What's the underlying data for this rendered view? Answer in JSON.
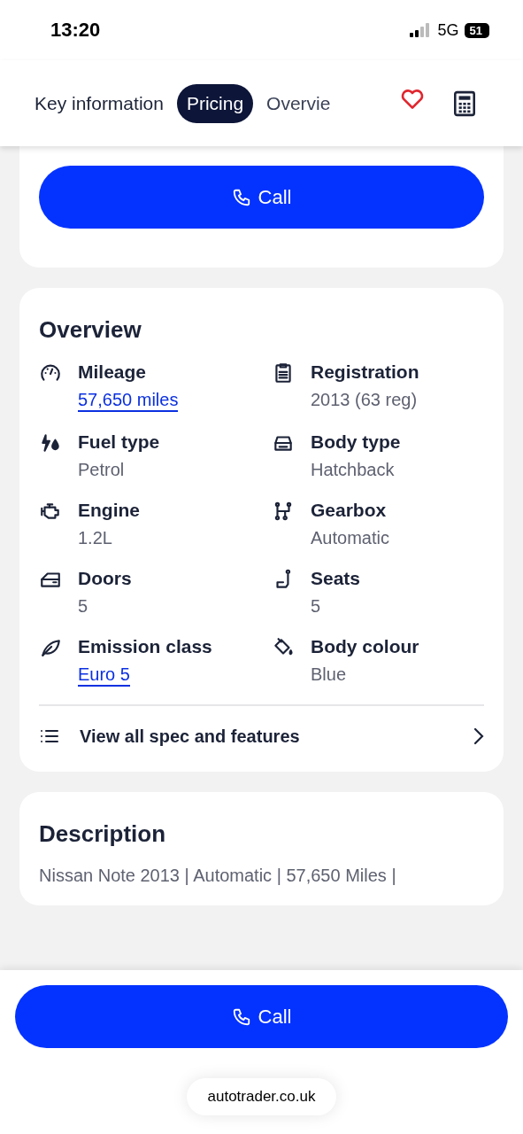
{
  "status_bar": {
    "time": "13:20",
    "network": "5G",
    "battery": "51"
  },
  "tabs": [
    {
      "label": "Key information",
      "selected": false
    },
    {
      "label": "Pricing",
      "selected": true
    },
    {
      "label": "Overvie",
      "selected": false
    }
  ],
  "top_card": {
    "button": "Call"
  },
  "overview": {
    "title": "Overview",
    "specs": [
      {
        "label": "Mileage",
        "value": "57,650 miles",
        "link": true
      },
      {
        "label": "Registration",
        "value": "2013 (63 reg)",
        "link": false
      },
      {
        "label": "Fuel type",
        "value": "Petrol",
        "link": false
      },
      {
        "label": "Body type",
        "value": "Hatchback",
        "link": false
      },
      {
        "label": "Engine",
        "value": "1.2L",
        "link": false
      },
      {
        "label": "Gearbox",
        "value": "Automatic",
        "link": false
      },
      {
        "label": "Doors",
        "value": "5",
        "link": false
      },
      {
        "label": "Seats",
        "value": "5",
        "link": false
      },
      {
        "label": "Emission class",
        "value": "Euro 5",
        "link": true
      },
      {
        "label": "Body colour",
        "value": "Blue",
        "link": false
      }
    ],
    "view_all": "View all spec and features"
  },
  "description": {
    "title": "Description",
    "text": "Nissan Note 2013 | Automatic | 57,650 Miles |"
  },
  "bottom_bar": {
    "button": "Call"
  },
  "browser": {
    "url": "autotrader.co.uk"
  }
}
